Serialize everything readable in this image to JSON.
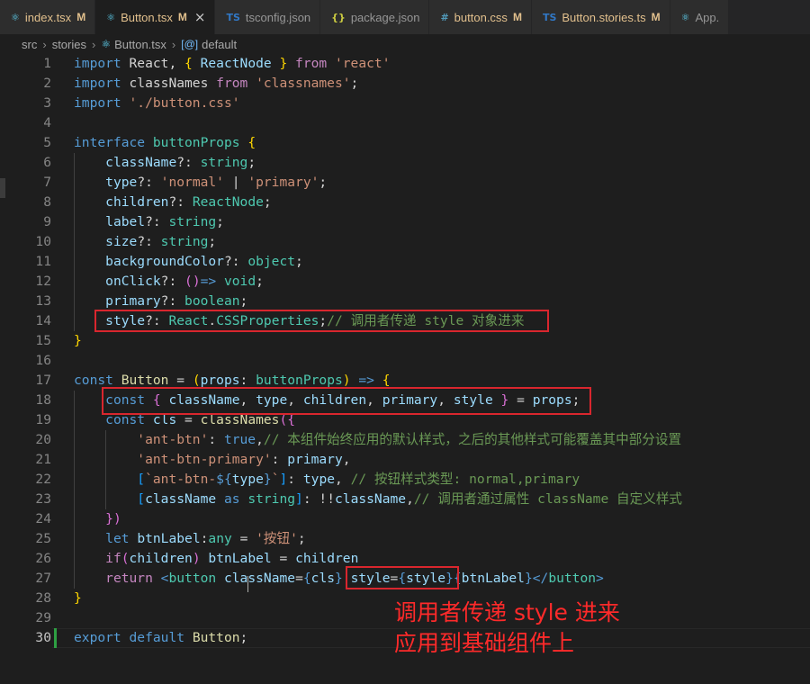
{
  "tabs": [
    {
      "icon": "⚛",
      "icon_color": "#61dafb",
      "name": "index.tsx",
      "status": "M",
      "active": false
    },
    {
      "icon": "⚛",
      "icon_color": "#61dafb",
      "name": "Button.tsx",
      "status": "M",
      "active": true,
      "close": "×"
    },
    {
      "icon": "TS",
      "icon_color": "#3178c6",
      "name": "tsconfig.json",
      "status": "",
      "active": false
    },
    {
      "icon": "{}",
      "icon_color": "#cbcb41",
      "name": "package.json",
      "status": "",
      "active": false
    },
    {
      "icon": "#",
      "icon_color": "#519aba",
      "name": "button.css",
      "status": "M",
      "active": false
    },
    {
      "icon": "TS",
      "icon_color": "#3178c6",
      "name": "Button.stories.ts",
      "status": "M",
      "active": false
    },
    {
      "icon": "⚛",
      "icon_color": "#61dafb",
      "name": "App.",
      "status": "",
      "active": false
    }
  ],
  "breadcrumb": [
    "src",
    "stories",
    "Button.tsx",
    "default"
  ],
  "status_color": "#e2c08d",
  "lines": [
    {
      "n": "1",
      "t": [
        [
          "kw",
          "import "
        ],
        [
          "plain",
          "React"
        ],
        [
          "plain",
          ", "
        ],
        [
          "br1",
          "{ "
        ],
        [
          "var",
          "ReactNode"
        ],
        [
          "br1",
          " }"
        ],
        [
          "ctl",
          " from "
        ],
        [
          "str",
          "'react'"
        ]
      ]
    },
    {
      "n": "2",
      "t": [
        [
          "kw",
          "import "
        ],
        [
          "plain",
          "classNames "
        ],
        [
          "ctl",
          "from "
        ],
        [
          "str",
          "'classnames'"
        ],
        [
          "plain",
          ";"
        ]
      ]
    },
    {
      "n": "3",
      "t": [
        [
          "kw",
          "import "
        ],
        [
          "str",
          "'./button.css'"
        ]
      ]
    },
    {
      "n": "4",
      "t": []
    },
    {
      "n": "5",
      "t": [
        [
          "kw",
          "interface "
        ],
        [
          "type",
          "buttonProps "
        ],
        [
          "br1",
          "{"
        ]
      ]
    },
    {
      "n": "6",
      "t": [
        [
          "plain",
          "    "
        ],
        [
          "var",
          "className"
        ],
        [
          "plain",
          "?: "
        ],
        [
          "type",
          "string"
        ],
        [
          "plain",
          ";"
        ]
      ]
    },
    {
      "n": "7",
      "t": [
        [
          "plain",
          "    "
        ],
        [
          "var",
          "type"
        ],
        [
          "plain",
          "?: "
        ],
        [
          "str",
          "'normal'"
        ],
        [
          "plain",
          " | "
        ],
        [
          "str",
          "'primary'"
        ],
        [
          "plain",
          ";"
        ]
      ]
    },
    {
      "n": "8",
      "t": [
        [
          "plain",
          "    "
        ],
        [
          "var",
          "children"
        ],
        [
          "plain",
          "?: "
        ],
        [
          "type",
          "ReactNode"
        ],
        [
          "plain",
          ";"
        ]
      ]
    },
    {
      "n": "9",
      "t": [
        [
          "plain",
          "    "
        ],
        [
          "var",
          "label"
        ],
        [
          "plain",
          "?: "
        ],
        [
          "type",
          "string"
        ],
        [
          "plain",
          ";"
        ]
      ]
    },
    {
      "n": "10",
      "t": [
        [
          "plain",
          "    "
        ],
        [
          "var",
          "size"
        ],
        [
          "plain",
          "?: "
        ],
        [
          "type",
          "string"
        ],
        [
          "plain",
          ";"
        ]
      ]
    },
    {
      "n": "11",
      "t": [
        [
          "plain",
          "    "
        ],
        [
          "var",
          "backgroundColor"
        ],
        [
          "plain",
          "?: "
        ],
        [
          "type",
          "object"
        ],
        [
          "plain",
          ";"
        ]
      ]
    },
    {
      "n": "12",
      "t": [
        [
          "plain",
          "    "
        ],
        [
          "var",
          "onClick"
        ],
        [
          "plain",
          "?: "
        ],
        [
          "br2",
          "()"
        ],
        [
          "kw",
          "=> "
        ],
        [
          "type",
          "void"
        ],
        [
          "plain",
          ";"
        ]
      ]
    },
    {
      "n": "13",
      "t": [
        [
          "plain",
          "    "
        ],
        [
          "var",
          "primary"
        ],
        [
          "plain",
          "?: "
        ],
        [
          "type",
          "boolean"
        ],
        [
          "plain",
          ";"
        ]
      ]
    },
    {
      "n": "14",
      "t": [
        [
          "plain",
          "    "
        ],
        [
          "var",
          "style"
        ],
        [
          "plain",
          "?: "
        ],
        [
          "type",
          "React"
        ],
        [
          "plain",
          "."
        ],
        [
          "type",
          "CSSProperties"
        ],
        [
          "plain",
          ";"
        ],
        [
          "cmt",
          "// 调用者传递 style 对象进来"
        ]
      ]
    },
    {
      "n": "15",
      "t": [
        [
          "br1",
          "}"
        ]
      ]
    },
    {
      "n": "16",
      "t": []
    },
    {
      "n": "17",
      "t": [
        [
          "kw",
          "const "
        ],
        [
          "fn",
          "Button "
        ],
        [
          "plain",
          "= "
        ],
        [
          "br1",
          "("
        ],
        [
          "var",
          "props"
        ],
        [
          "plain",
          ": "
        ],
        [
          "type",
          "buttonProps"
        ],
        [
          "br1",
          ")"
        ],
        [
          "kw",
          " => "
        ],
        [
          "br1",
          "{"
        ]
      ]
    },
    {
      "n": "18",
      "t": [
        [
          "plain",
          "    "
        ],
        [
          "kw",
          "const "
        ],
        [
          "br2",
          "{ "
        ],
        [
          "var",
          "className"
        ],
        [
          "plain",
          ", "
        ],
        [
          "var",
          "type"
        ],
        [
          "plain",
          ", "
        ],
        [
          "var",
          "children"
        ],
        [
          "plain",
          ", "
        ],
        [
          "var",
          "primary"
        ],
        [
          "plain",
          ", "
        ],
        [
          "var",
          "style"
        ],
        [
          "br2",
          " }"
        ],
        [
          "plain",
          " = "
        ],
        [
          "var",
          "props"
        ],
        [
          "plain",
          ";"
        ]
      ]
    },
    {
      "n": "19",
      "t": [
        [
          "plain",
          "    "
        ],
        [
          "kw",
          "const "
        ],
        [
          "var",
          "cls "
        ],
        [
          "plain",
          "= "
        ],
        [
          "fn",
          "classNames"
        ],
        [
          "br2",
          "({"
        ]
      ]
    },
    {
      "n": "20",
      "t": [
        [
          "plain",
          "        "
        ],
        [
          "str",
          "'ant-btn'"
        ],
        [
          "plain",
          ": "
        ],
        [
          "kw",
          "true"
        ],
        [
          "plain",
          ","
        ],
        [
          "cmt",
          "// 本组件始终应用的默认样式，之后的其他样式可能覆盖其中部分设置"
        ]
      ]
    },
    {
      "n": "21",
      "t": [
        [
          "plain",
          "        "
        ],
        [
          "str",
          "'ant-btn-primary'"
        ],
        [
          "plain",
          ": "
        ],
        [
          "var",
          "primary"
        ],
        [
          "plain",
          ","
        ]
      ]
    },
    {
      "n": "22",
      "t": [
        [
          "plain",
          "        "
        ],
        [
          "br3",
          "["
        ],
        [
          "str",
          "`ant-btn-"
        ],
        [
          "kw",
          "${"
        ],
        [
          "var",
          "type"
        ],
        [
          "kw",
          "}"
        ],
        [
          "str",
          "`"
        ],
        [
          "br3",
          "]"
        ],
        [
          "plain",
          ": "
        ],
        [
          "var",
          "type"
        ],
        [
          "plain",
          ", "
        ],
        [
          "cmt",
          "// 按钮样式类型: normal,primary"
        ]
      ]
    },
    {
      "n": "23",
      "t": [
        [
          "plain",
          "        "
        ],
        [
          "br3",
          "["
        ],
        [
          "var",
          "className "
        ],
        [
          "kw",
          "as "
        ],
        [
          "type",
          "string"
        ],
        [
          "br3",
          "]"
        ],
        [
          "plain",
          ": !!"
        ],
        [
          "var",
          "className"
        ],
        [
          "plain",
          ","
        ],
        [
          "cmt",
          "// 调用者通过属性 className 自定义样式"
        ]
      ]
    },
    {
      "n": "24",
      "t": [
        [
          "plain",
          "    "
        ],
        [
          "br2",
          "})"
        ]
      ]
    },
    {
      "n": "25",
      "t": [
        [
          "plain",
          "    "
        ],
        [
          "kw",
          "let "
        ],
        [
          "var",
          "btnLabel"
        ],
        [
          "plain",
          ":"
        ],
        [
          "type",
          "any "
        ],
        [
          "plain",
          "= "
        ],
        [
          "str",
          "'按钮'"
        ],
        [
          "plain",
          ";"
        ]
      ]
    },
    {
      "n": "26",
      "t": [
        [
          "plain",
          "    "
        ],
        [
          "ctl",
          "if"
        ],
        [
          "br2",
          "("
        ],
        [
          "var",
          "children"
        ],
        [
          "br2",
          ")"
        ],
        [
          "var",
          " btnLabel "
        ],
        [
          "plain",
          "= "
        ],
        [
          "var",
          "children"
        ]
      ]
    },
    {
      "n": "27",
      "t": [
        [
          "plain",
          "    "
        ],
        [
          "ctl",
          "return "
        ],
        [
          "kw",
          "<"
        ],
        [
          "type",
          "button "
        ],
        [
          "var",
          "className"
        ],
        [
          "plain",
          "="
        ],
        [
          "kw",
          "{"
        ],
        [
          "var",
          "cls"
        ],
        [
          "kw",
          "} "
        ],
        [
          "var",
          "style"
        ],
        [
          "plain",
          "="
        ],
        [
          "kw",
          "{"
        ],
        [
          "var",
          "style"
        ],
        [
          "kw",
          "}"
        ],
        [
          "kw",
          "{"
        ],
        [
          "var",
          "btnLabel"
        ],
        [
          "kw",
          "}"
        ],
        [
          "kw",
          "</"
        ],
        [
          "type",
          "button"
        ],
        [
          "kw",
          ">"
        ]
      ]
    },
    {
      "n": "28",
      "t": [
        [
          "br1",
          "}"
        ]
      ]
    },
    {
      "n": "29",
      "t": []
    },
    {
      "n": "30",
      "t": [
        [
          "kw",
          "export "
        ],
        [
          "kw",
          "default "
        ],
        [
          "fn",
          "Button"
        ],
        [
          "plain",
          ";"
        ]
      ]
    }
  ],
  "annotation": {
    "line1": "调用者传递 style 进来",
    "line2": "应用到基础组件上"
  }
}
